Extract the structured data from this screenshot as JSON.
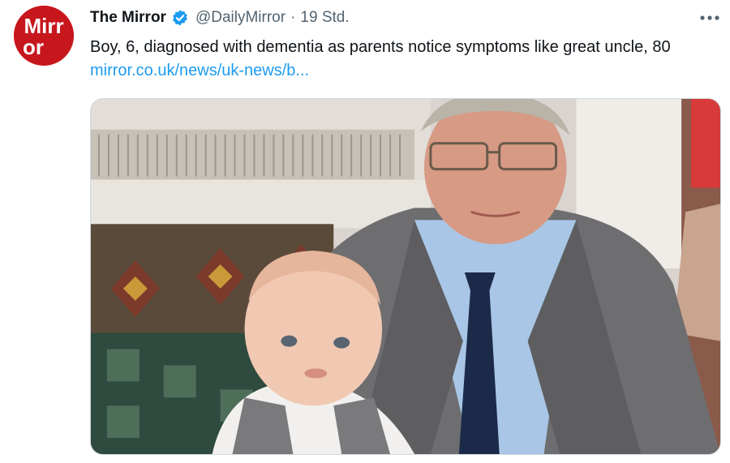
{
  "tweet": {
    "author_name": "The Mirror",
    "handle": "@DailyMirror",
    "separator": "·",
    "time": "19 Std.",
    "text_before_link": "Boy, 6, diagnosed with dementia as parents notice symptoms like great uncle, 80 ",
    "link_text": "mirror.co.uk/news/uk-news/b...",
    "avatar_logo": "Mirror",
    "verified": true
  },
  "icons": {
    "more": "more-horizontal-icon",
    "verified": "verified-badge-icon"
  },
  "colors": {
    "brand_red": "#c8161d",
    "link_blue": "#1d9bf0",
    "verified_blue": "#1d9bf0",
    "meta_gray": "#536471"
  }
}
